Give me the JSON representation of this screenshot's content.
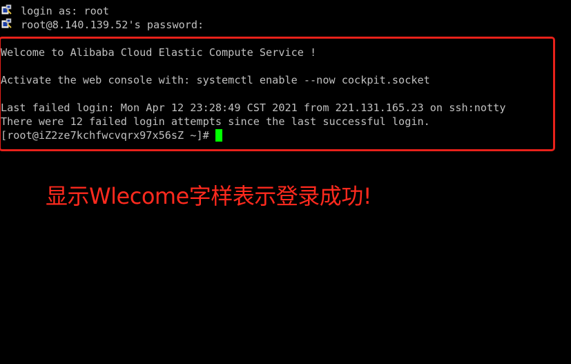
{
  "session": {
    "login_line": "login as: root",
    "password_line": "root@8.140.139.52's password:",
    "icon": "putty-key-icon"
  },
  "output": {
    "welcome": "Welcome to Alibaba Cloud Elastic Compute Service !",
    "activate": "Activate the web console with: systemctl enable --now cockpit.socket",
    "last_failed": "Last failed login: Mon Apr 12 23:28:49 CST 2021 from 221.131.165.23 on ssh:notty",
    "failed_attempts": "There were 12 failed login attempts since the last successful login.",
    "prompt": "[root@iZ2ze7kchfwcvqrx97x56sZ ~]# "
  },
  "annotation": {
    "text": "显示Wlecome字样表示登录成功!",
    "box_color": "#e8211a",
    "text_color": "#ff2a1e"
  },
  "colors": {
    "background": "#000000",
    "text": "#c0c0c0",
    "cursor": "#00ff00"
  }
}
